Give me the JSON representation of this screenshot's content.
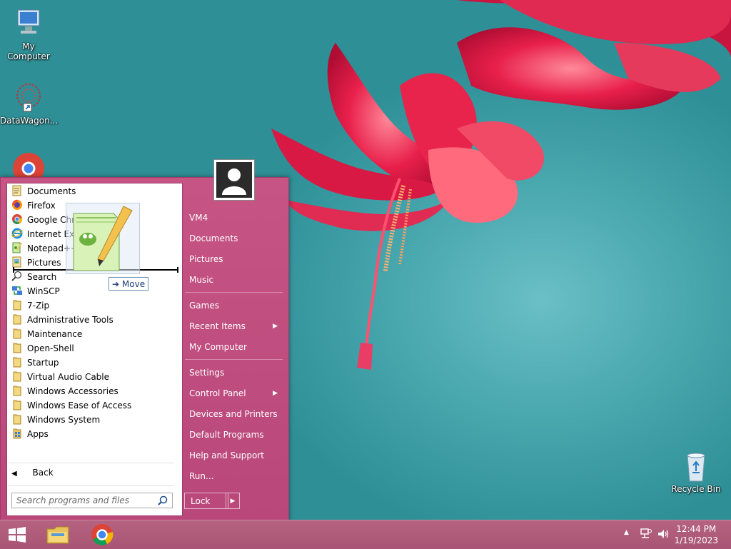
{
  "desktop": {
    "icons": [
      {
        "label": "My Computer"
      },
      {
        "label": "DataWagon..."
      },
      {
        "label": "Recycle Bin"
      }
    ]
  },
  "start_menu": {
    "programs": [
      {
        "label": "Documents",
        "icon": "documents-icon"
      },
      {
        "label": "Firefox",
        "icon": "firefox-icon"
      },
      {
        "label": "Google Chrome",
        "icon": "chrome-icon"
      },
      {
        "label": "Internet Explorer",
        "icon": "ie-icon"
      },
      {
        "label": "Notepad++",
        "icon": "notepadpp-icon"
      },
      {
        "label": "Pictures",
        "icon": "pictures-icon"
      },
      {
        "label": "Search",
        "icon": "search-icon"
      },
      {
        "label": "WinSCP",
        "icon": "winscp-icon"
      },
      {
        "label": "7-Zip",
        "icon": "folder-icon"
      },
      {
        "label": "Administrative Tools",
        "icon": "folder-icon"
      },
      {
        "label": "Maintenance",
        "icon": "folder-icon"
      },
      {
        "label": "Open-Shell",
        "icon": "folder-icon"
      },
      {
        "label": "Startup",
        "icon": "folder-icon"
      },
      {
        "label": "Virtual Audio Cable",
        "icon": "folder-icon"
      },
      {
        "label": "Windows Accessories",
        "icon": "folder-icon"
      },
      {
        "label": "Windows Ease of Access",
        "icon": "folder-icon"
      },
      {
        "label": "Windows System",
        "icon": "folder-icon"
      },
      {
        "label": "Apps",
        "icon": "apps-icon"
      }
    ],
    "back_label": "Back",
    "search_placeholder": "Search programs and files",
    "drag_tooltip": "Move",
    "right_items": [
      {
        "label": "VM4"
      },
      {
        "label": "Documents"
      },
      {
        "label": "Pictures"
      },
      {
        "label": "Music"
      },
      {
        "label": "Games"
      },
      {
        "label": "Recent Items",
        "submenu": true
      },
      {
        "label": "My Computer"
      },
      {
        "label": "Settings"
      },
      {
        "label": "Control Panel",
        "submenu": true
      },
      {
        "label": "Devices and Printers"
      },
      {
        "label": "Default Programs"
      },
      {
        "label": "Help and Support"
      },
      {
        "label": "Run..."
      }
    ],
    "lock_label": "Lock",
    "colors": {
      "menu_bg": "#c04f7f",
      "accent_border": "#9c3a66"
    }
  },
  "taskbar": {
    "pinned": [
      {
        "icon": "file-explorer-icon"
      },
      {
        "icon": "chrome-icon"
      }
    ],
    "clock": {
      "time": "12:44 PM",
      "date": "1/19/2023"
    }
  }
}
